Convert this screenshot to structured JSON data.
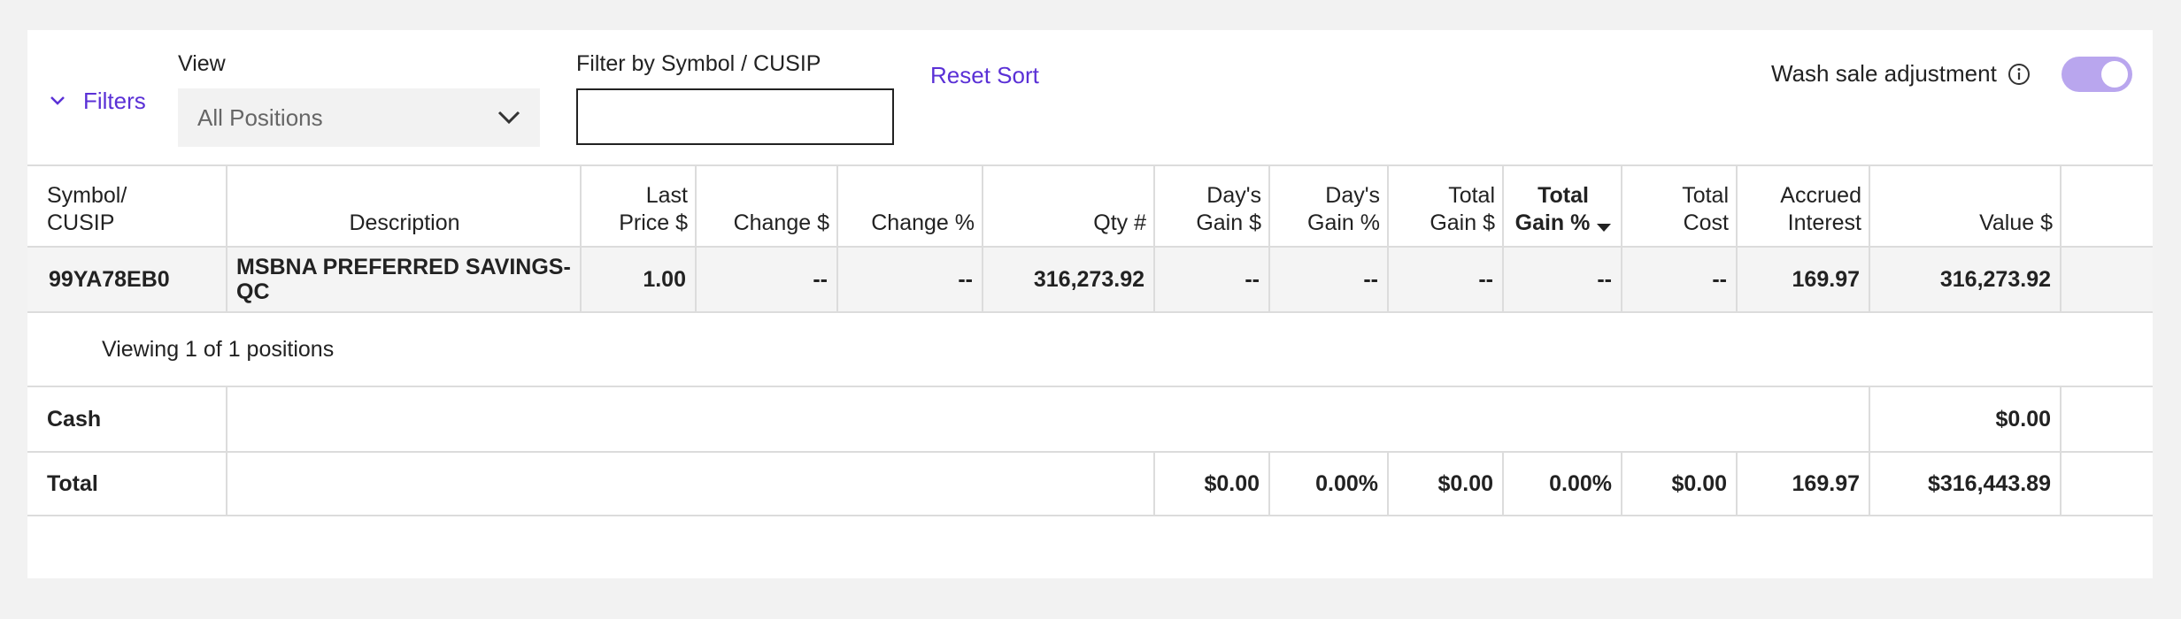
{
  "filters": {
    "label": "Filters"
  },
  "view": {
    "label": "View",
    "selected": "All Positions"
  },
  "symbol_filter": {
    "label": "Filter by Symbol / CUSIP",
    "value": ""
  },
  "reset_sort": "Reset Sort",
  "wash_sale": {
    "label": "Wash sale adjustment",
    "enabled": true
  },
  "colors": {
    "accent": "#5a30d6",
    "toggle_on": "#b9a6ee"
  },
  "table": {
    "headers": {
      "symbol_l1": "Symbol/",
      "symbol_l2": "CUSIP",
      "description": "Description",
      "last_price_l1": "Last",
      "last_price_l2": "Price $",
      "change_usd": "Change $",
      "change_pct": "Change %",
      "qty": "Qty #",
      "days_gain_usd_l1": "Day's",
      "days_gain_usd_l2": "Gain $",
      "days_gain_pct_l1": "Day's",
      "days_gain_pct_l2": "Gain %",
      "total_gain_usd_l1": "Total",
      "total_gain_usd_l2": "Gain $",
      "total_gain_pct_l1": "Total",
      "total_gain_pct_l2": "Gain %",
      "total_cost_l1": "Total",
      "total_cost_l2": "Cost",
      "accrued_interest_l1": "Accrued",
      "accrued_interest_l2": "Interest",
      "value": "Value $"
    },
    "sorted_column": "Total Gain %",
    "sort_direction": "descending",
    "rows": [
      {
        "symbol": "99YA78EB0",
        "description": "MSBNA PREFERRED SAVINGS-QC",
        "last_price": "1.00",
        "change_usd": "--",
        "change_pct": "--",
        "qty": "316,273.92",
        "days_gain_usd": "--",
        "days_gain_pct": "--",
        "total_gain_usd": "--",
        "total_gain_pct": "--",
        "total_cost": "--",
        "accrued_interest": "169.97",
        "value": "316,273.92"
      }
    ],
    "viewing_text": "Viewing 1 of 1 positions",
    "cash": {
      "label": "Cash",
      "value": "$0.00"
    },
    "total": {
      "label": "Total",
      "days_gain_usd": "$0.00",
      "days_gain_pct": "0.00%",
      "total_gain_usd": "$0.00",
      "total_gain_pct": "0.00%",
      "total_cost": "$0.00",
      "accrued_interest": "169.97",
      "value": "$316,443.89"
    }
  }
}
